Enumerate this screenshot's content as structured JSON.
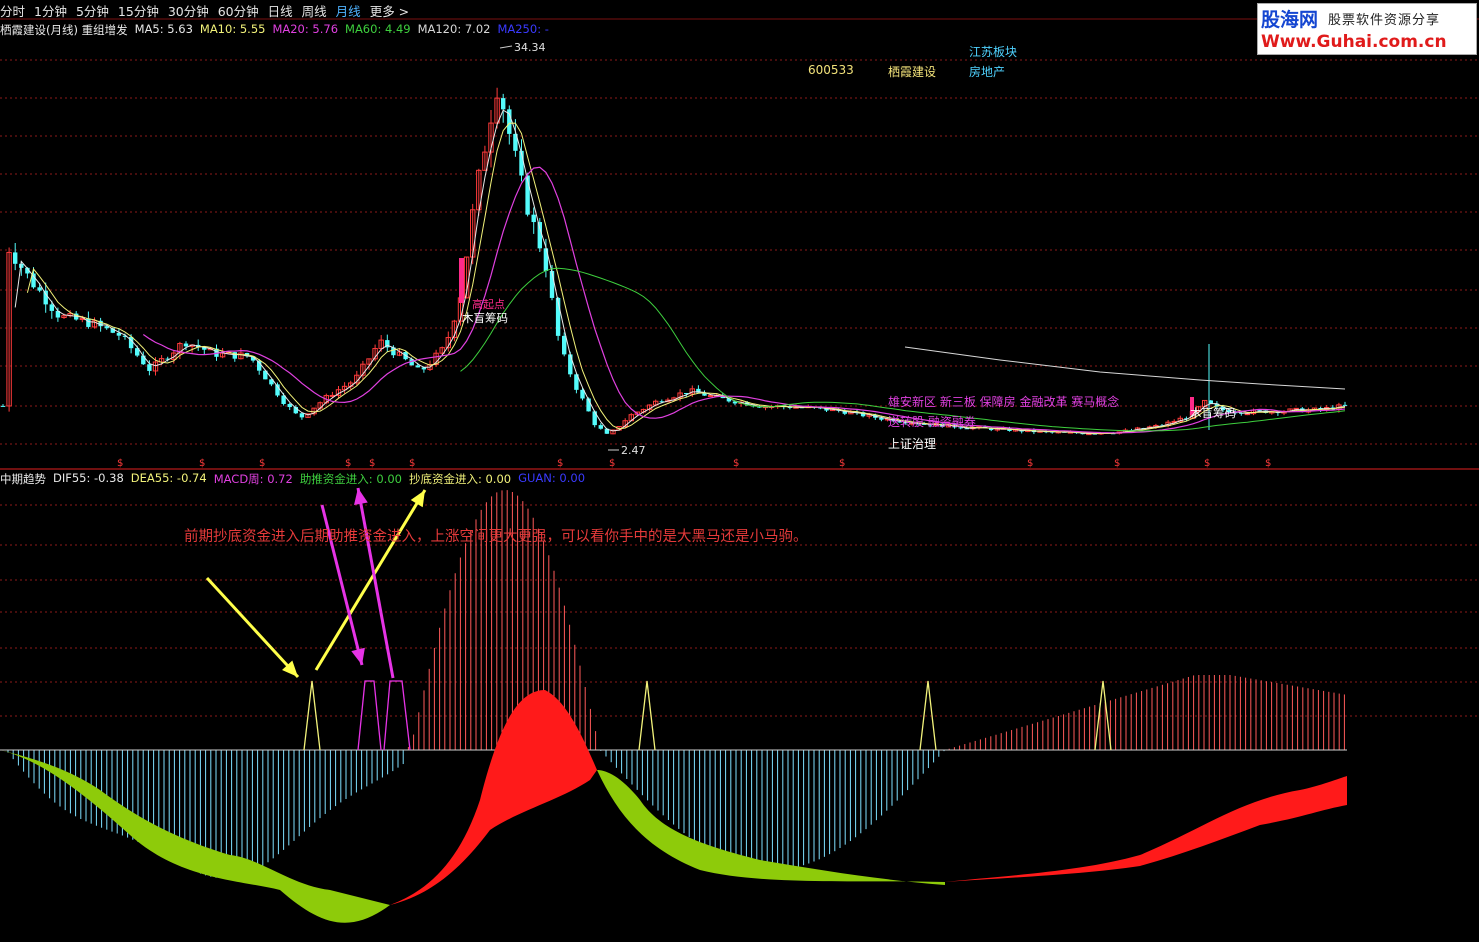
{
  "tabs": [
    "分时",
    "1分钟",
    "5分钟",
    "15分钟",
    "30分钟",
    "60分钟",
    "日线",
    "周线",
    "月线",
    "更多 >"
  ],
  "active_tab": "月线",
  "logo": {
    "name": "股海网",
    "slogan": "股票软件资源分享",
    "url": "Www.Guhai.com.cn"
  },
  "main_legend": {
    "title": "栖霞建设(月线) 重组增发",
    "ma5": "MA5: 5.63",
    "ma10": "MA10: 5.55",
    "ma20": "MA20: 5.76",
    "ma60": "MA60: 4.49",
    "ma120": "MA120: 7.02",
    "ma250": "MA250: -"
  },
  "stock": {
    "code": "600533",
    "name": "栖霞建设",
    "sector": "江苏板块",
    "industry": "房地产"
  },
  "price_high": "34.34",
  "price_low": "2.47",
  "labels": {
    "chip1": "木盲筹码",
    "chip2": "木盲筹码",
    "concept1": "雄安新区 新三板 保障房 金融改革 赛马概念",
    "concept2": "送转股 融资融券",
    "concept3": "上证治理",
    "low_point": "高起点"
  },
  "sub_legend": {
    "title": "中期趋势",
    "dif": "DIF55: -0.38",
    "dea": "DEA55: -0.74",
    "macd": "MACD周: 0.72",
    "push": "助推资金进入: 0.00",
    "bottom": "抄底资金进入: 0.00",
    "guan": "GUAN: 0.00"
  },
  "annotation": "前期抄底资金进入后期助推资金进入，上涨空间更大更强，可以看你手中的是大黑马还是小马驹。",
  "colors": {
    "up": "#ff3b3b",
    "down": "#54fcfc",
    "ma5": "#e8e8e8",
    "ma10": "#f2f27a",
    "ma20": "#e040e0",
    "ma60": "#3ecf3e",
    "ma120": "#d8d8d8",
    "ma250": "#3a3aff",
    "macd_pos": "#ff5a5a",
    "macd_neg": "#7fe0ff",
    "band_red": "#ff1a1a",
    "band_green": "#8ecb0a",
    "grid": "#8b1a1a",
    "arrow_yellow": "#ffff4a",
    "arrow_magenta": "#e633e6"
  }
}
